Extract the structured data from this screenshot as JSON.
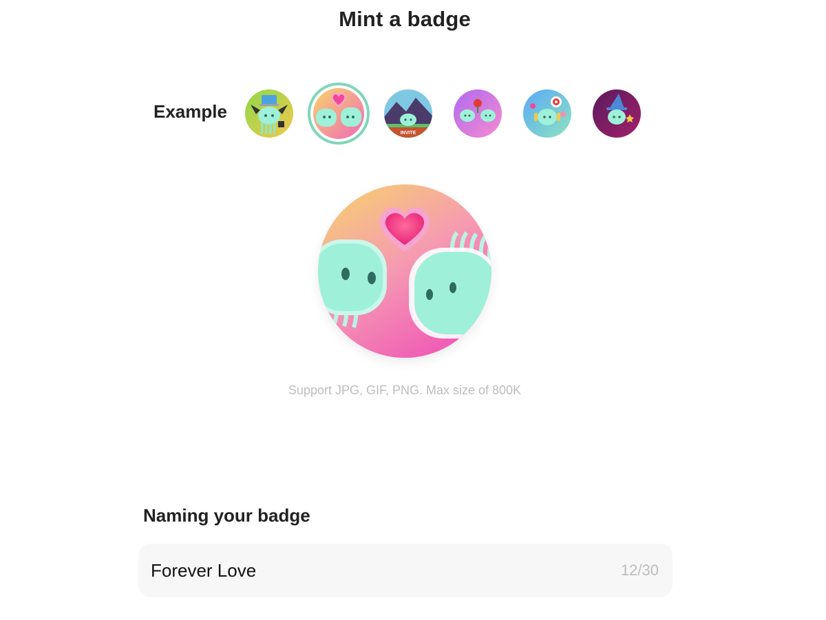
{
  "header": {
    "title": "Mint a badge"
  },
  "examples": {
    "label": "Example",
    "items": [
      {
        "name": "computer-jellyfish-badge",
        "selected": false
      },
      {
        "name": "love-jellyfish-badge",
        "selected": true
      },
      {
        "name": "invite-mountain-badge",
        "text": "INVITE",
        "selected": false
      },
      {
        "name": "flower-jellyfish-badge",
        "selected": false
      },
      {
        "name": "target-jellyfish-badge",
        "selected": false
      },
      {
        "name": "wizard-jellyfish-badge",
        "selected": false
      }
    ],
    "selected_ring_color": "#7fd6b8"
  },
  "preview": {
    "support_text": "Support JPG, GIF, PNG. Max size of 800K"
  },
  "naming": {
    "heading": "Naming your badge",
    "value": "Forever Love",
    "counter": "12/30"
  },
  "colors": {
    "text": "#222222",
    "muted": "#bdbdbd",
    "field_bg": "#f7f7f7"
  }
}
